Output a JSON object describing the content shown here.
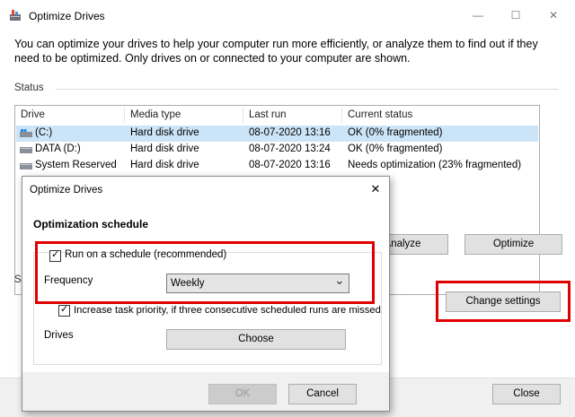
{
  "window": {
    "title": "Optimize Drives",
    "controls": {
      "minimize": "—",
      "maximize": "☐",
      "close": "✕"
    }
  },
  "intro_text": "You can optimize your drives to help your computer run more efficiently, or analyze them to find out if they need to be optimized. Only drives on or connected to your computer are shown.",
  "status_label": "Status",
  "drives_table": {
    "columns": [
      "Drive",
      "Media type",
      "Last run",
      "Current status"
    ],
    "rows": [
      {
        "drive": "(C:)",
        "media": "Hard disk drive",
        "last_run": "08-07-2020 13:16",
        "status": "OK (0% fragmented)",
        "selected": true
      },
      {
        "drive": "DATA (D:)",
        "media": "Hard disk drive",
        "last_run": "08-07-2020 13:24",
        "status": "OK (0% fragmented)",
        "selected": false
      },
      {
        "drive": "System Reserved",
        "media": "Hard disk drive",
        "last_run": "08-07-2020 13:16",
        "status": "Needs optimization (23% fragmented)",
        "selected": false
      }
    ]
  },
  "buttons": {
    "analyze": "Analyze",
    "optimize": "Optimize",
    "change_settings": "Change settings",
    "close": "Close"
  },
  "scheduled_label_partial": "Sc",
  "dialog": {
    "title": "Optimize Drives",
    "close_glyph": "✕",
    "heading": "Optimization schedule",
    "run_on_schedule": {
      "label": "Run on a schedule (recommended)",
      "checked": true
    },
    "frequency": {
      "label": "Frequency",
      "value": "Weekly",
      "arrow": "⌄"
    },
    "increase_priority": {
      "label": "Increase task priority, if three consecutive scheduled runs are missed",
      "checked": true
    },
    "drives_label": "Drives",
    "choose_button": "Choose",
    "ok_button": "OK",
    "cancel_button": "Cancel"
  },
  "colors": {
    "highlight": "#e00000",
    "selection": "#cce4f7",
    "button_face": "#e1e1e1"
  }
}
